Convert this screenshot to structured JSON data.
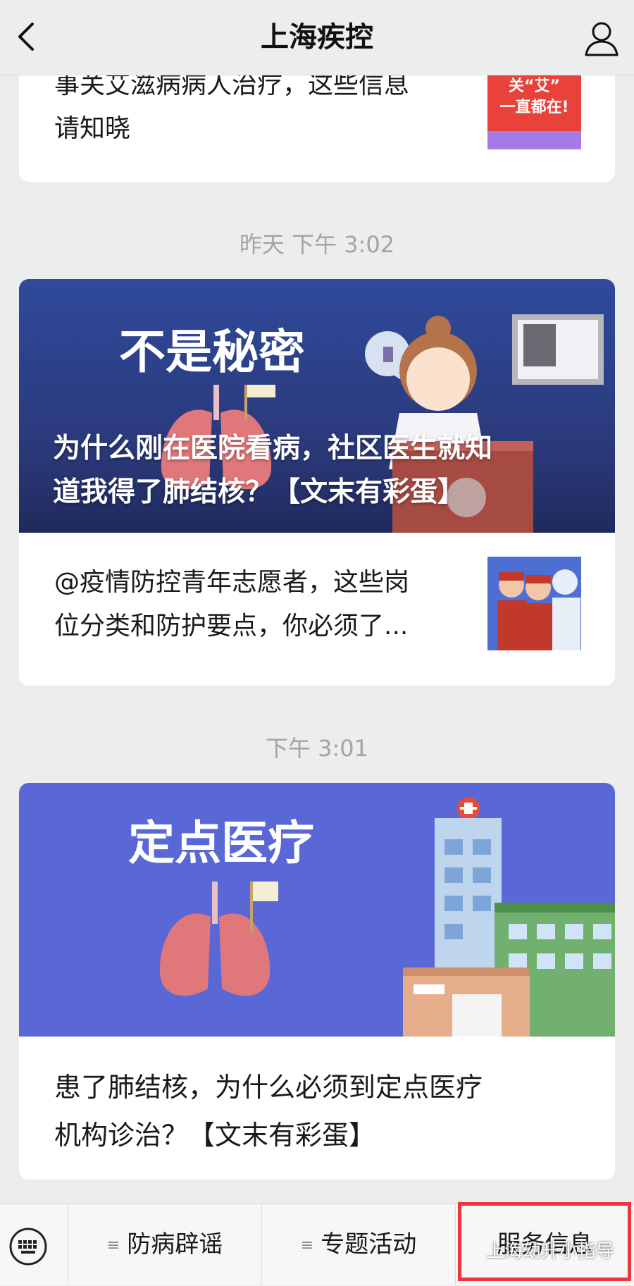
{
  "header": {
    "title": "上海疾控"
  },
  "feed": {
    "top_item": {
      "text_line1": "事关艾滋病病人治疗，这些信息",
      "text_line2": "请知晓",
      "thumb_text_line1": "关“艾”",
      "thumb_text_line2": "一直都在!"
    },
    "group1": {
      "timestamp": "昨天 下午 3:02",
      "cover_banner": "不是秘密",
      "cover_title_line1": "为什么刚在医院看病，社区医生就知",
      "cover_title_line2": "道我得了肺结核？【文末有彩蛋】",
      "sub_item": {
        "text_line1": "@疫情防控青年志愿者，这些岗",
        "text_line2": "位分类和防护要点，你必须了..."
      }
    },
    "group2": {
      "timestamp": "下午 3:01",
      "cover_banner": "定点医疗",
      "title_line1": "患了肺结核，为什么必须到定点医疗",
      "title_line2": "机构诊治？【文末有彩蛋】"
    }
  },
  "menu": {
    "items": [
      {
        "label": "防病辟谣"
      },
      {
        "label": "专题活动"
      },
      {
        "label": "服务信息"
      }
    ]
  },
  "watermark": "上海幼升小指导",
  "colors": {
    "background": "#ededed",
    "cover1": "#2c3a7c",
    "cover2": "#5565d8",
    "highlight": "#f0343f"
  }
}
